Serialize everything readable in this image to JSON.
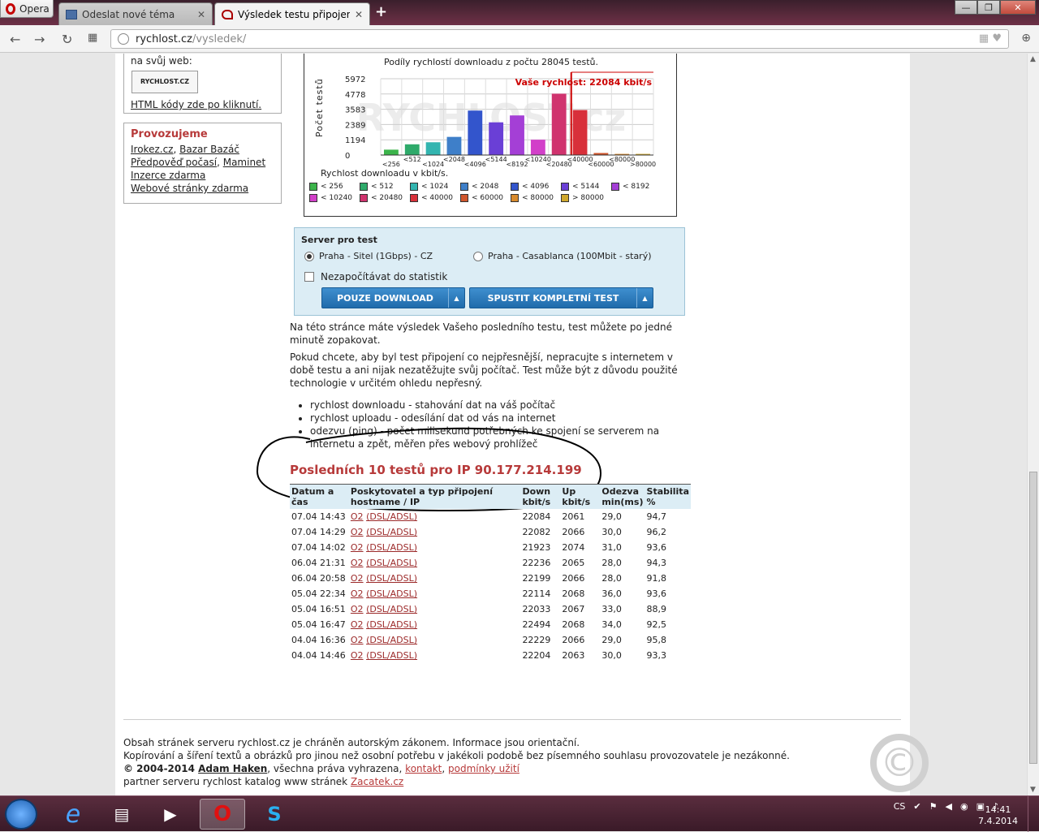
{
  "browser": {
    "menu_label": "Opera",
    "tabs": [
      {
        "label": "Odeslat nové téma",
        "close": "✕"
      },
      {
        "label": "Výsledek testu připojení k i",
        "close": "✕"
      }
    ],
    "new_tab": "+",
    "url_host": "rychlost.cz",
    "url_path": "/vysledek/"
  },
  "sidebar": {
    "web_text": "na svůj web:",
    "logo_text": "RYCHLOST.CZ",
    "html_link": "HTML kódy zde po kliknutí.",
    "provozujeme_title": "Provozujeme",
    "links": [
      "Irokez.cz",
      "Bazar Bazáč",
      "Předpověď počasí",
      "Maminet",
      "Inzerce zdarma",
      "Webové stránky zdarma"
    ]
  },
  "chart_data": {
    "type": "bar",
    "title": "Podíly rychlostí downloadu z počtu 28045 testů.",
    "ylabel": "Počet testů",
    "xlabel": "Rychlost downloadu v kbit/s.",
    "watermark": "RYCHLOST.cz",
    "yticks": [
      "5972",
      "4778",
      "3583",
      "2389",
      "1194",
      "0"
    ],
    "ylim": [
      0,
      5972
    ],
    "categories": [
      "<256",
      "<512",
      "<1024",
      "<2048",
      "<4096",
      "<5144",
      "<8192",
      "<10240",
      "<20480",
      "<40000",
      "<60000",
      "<80000",
      ">80000"
    ],
    "values": [
      420,
      840,
      1000,
      1420,
      3480,
      2560,
      3100,
      1200,
      4800,
      3520,
      160,
      90,
      90
    ],
    "colors": [
      "#3cb44b",
      "#2eaa6a",
      "#33b5b0",
      "#3e7fc9",
      "#3355cc",
      "#6a3fd6",
      "#a43fd6",
      "#d23fc9",
      "#d0336e",
      "#d8303a",
      "#d0562c",
      "#d88a2c",
      "#d0a82c"
    ],
    "your_speed_label": "Vaše rychlost: 22084 kbit/s",
    "your_speed": 22084,
    "legend": [
      "< 256",
      "< 512",
      "< 1024",
      "< 2048",
      "< 4096",
      "< 5144",
      "< 8192",
      "< 10240",
      "< 20480",
      "< 40000",
      "< 60000",
      "< 80000",
      "> 80000"
    ]
  },
  "server": {
    "title": "Server pro test",
    "option1": "Praha - Sitel (1Gbps) - CZ",
    "option2": "Praha - Casablanca (100Mbit - starý)",
    "checkbox": "Nezapočítávat do statistik",
    "btn_download": "POUZE DOWNLOAD",
    "btn_full": "SPUSTIT KOMPLETNÍ TEST",
    "arrow": "▲"
  },
  "info": {
    "p1": "Na této stránce máte výsledek Vašeho posledního testu, test můžete po jedné minutě zopakovat.",
    "p2": "Pokud chcete, aby byl test připojení co nejpřesnější, nepracujte s internetem v době testu a ani nijak nezatěžujte svůj počítač. Test může být z důvodu použité technologie v určitém ohledu nepřesný.",
    "bullets": [
      "rychlost downloadu - stahování dat na váš počítač",
      "rychlost uploadu - odesílání dat od vás na internet",
      "odezvu (ping) - počet milisekund potřebných ke spojení se serverem na internetu a zpět, měřen přes webový prohlížeč"
    ]
  },
  "results": {
    "title": "Posledních 10 testů pro IP 90.177.214.199",
    "headers": [
      "Datum a čas",
      "Poskytovatel a typ připojení hostname / IP",
      "Down kbit/s",
      "Up kbit/s",
      "Odezva min(ms)",
      "Stabilita %"
    ],
    "rows": [
      [
        "07.04 14:43",
        "O2",
        "(DSL/ADSL)",
        "22084",
        "2061",
        "29,0",
        "94,7"
      ],
      [
        "07.04 14:29",
        "O2",
        "(DSL/ADSL)",
        "22082",
        "2066",
        "30,0",
        "96,2"
      ],
      [
        "07.04 14:02",
        "O2",
        "(DSL/ADSL)",
        "21923",
        "2074",
        "31,0",
        "93,6"
      ],
      [
        "06.04 21:31",
        "O2",
        "(DSL/ADSL)",
        "22236",
        "2065",
        "28,0",
        "94,3"
      ],
      [
        "06.04 20:58",
        "O2",
        "(DSL/ADSL)",
        "22199",
        "2066",
        "28,0",
        "91,8"
      ],
      [
        "05.04 22:34",
        "O2",
        "(DSL/ADSL)",
        "22114",
        "2068",
        "36,0",
        "93,6"
      ],
      [
        "05.04 16:51",
        "O2",
        "(DSL/ADSL)",
        "22033",
        "2067",
        "33,0",
        "88,9"
      ],
      [
        "05.04 16:47",
        "O2",
        "(DSL/ADSL)",
        "22494",
        "2068",
        "34,0",
        "92,5"
      ],
      [
        "04.04 16:36",
        "O2",
        "(DSL/ADSL)",
        "22229",
        "2066",
        "29,0",
        "95,8"
      ],
      [
        "04.04 14:46",
        "O2",
        "(DSL/ADSL)",
        "22204",
        "2063",
        "30,0",
        "93,3"
      ]
    ]
  },
  "footer": {
    "line1": "Obsah stránek serveru rychlost.cz je chráněn autorským zákonem. Informace jsou orientační.",
    "line2": "Kopírování a šíření textů a obrázků pro jinou než osobní potřebu v jakékoli podobě bez písemného souhlasu provozovatele je nezákonné.",
    "copy_prefix": "© 2004-2014 ",
    "copy_name": "Adam Haken",
    "copy_mid": ", všechna práva vyhrazena, ",
    "contact": "kontakt",
    "sep": ", ",
    "terms": "podmínky užití",
    "partner_prefix": "partner serveru rychlost katalog www stránek ",
    "partner_link": "Zacatek.cz",
    "copyright_glyph": "©"
  },
  "taskbar": {
    "lang": "CS",
    "time": "14:41",
    "date": "7.4.2014"
  }
}
